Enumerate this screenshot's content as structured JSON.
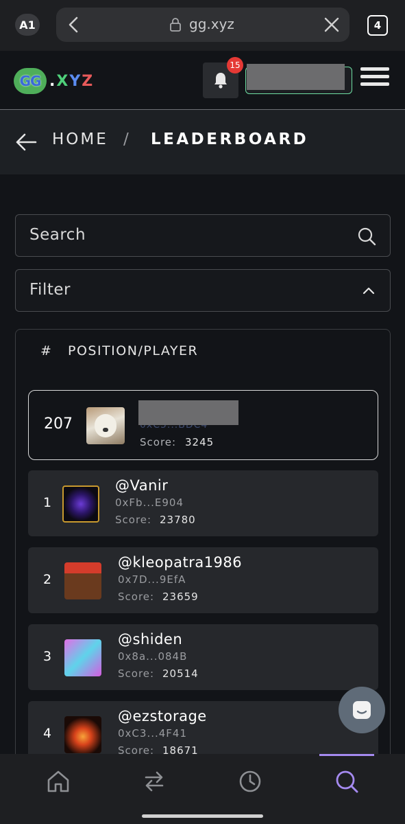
{
  "browser": {
    "profile_badge": "A1",
    "url": "gg.xyz",
    "tabs_count": "4"
  },
  "header": {
    "logo_mark": "GG",
    "logo_dot": ".",
    "logo_x": "X",
    "logo_y": "Y",
    "logo_z": "Z",
    "notification_count": "15"
  },
  "breadcrumb": {
    "home": "HOME",
    "separator": "/",
    "current": "LEADERBOARD"
  },
  "search": {
    "placeholder": "Search"
  },
  "filter": {
    "label": "Filter"
  },
  "leaderboard": {
    "col_hash": "#",
    "col_header": "POSITION/PLAYER",
    "current_user": {
      "rank": "207",
      "address": "0xC5...BDC4",
      "score_label": "Score:",
      "score": "3245"
    },
    "players": [
      {
        "rank": "1",
        "name": "@Vanir",
        "address": "0xFb...E904",
        "score_label": "Score:",
        "score": "23780"
      },
      {
        "rank": "2",
        "name": "@kleopatra1986",
        "address": "0x7D...9EfA",
        "score_label": "Score:",
        "score": "23659"
      },
      {
        "rank": "3",
        "name": "@shiden",
        "address": "0x8a...084B",
        "score_label": "Score:",
        "score": "20514"
      },
      {
        "rank": "4",
        "name": "@ezstorage",
        "address": "0xC3...4F41",
        "score_label": "Score:",
        "score": "18671"
      }
    ]
  },
  "bottom_nav": {
    "items": [
      "home-icon",
      "swap-icon",
      "history-icon",
      "search-icon"
    ],
    "active": "search-icon",
    "accent": "#a58af0"
  },
  "colors": {
    "background": "#121418",
    "row_background": "#26282c",
    "wallet_border": "#6fe0a4",
    "badge": "#e53935"
  }
}
